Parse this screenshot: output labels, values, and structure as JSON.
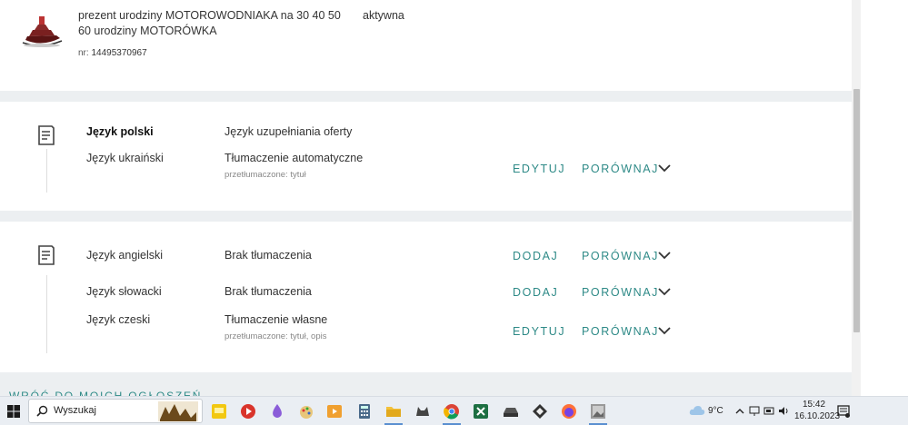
{
  "offer": {
    "title": "prezent urodziny MOTOROWODNIAKA na 30 40 50 60 urodziny MOTORÓWKA",
    "status": "aktywna",
    "nr_label": "nr:",
    "nr_value": "14495370967"
  },
  "section1": {
    "rows": [
      {
        "language": "Język polski",
        "status": "Język uzupełniania oferty",
        "sub": ""
      },
      {
        "language": "Język ukraiński",
        "status": "Tłumaczenie automatyczne",
        "sub": "przetłumaczone: tytuł"
      }
    ],
    "actions": {
      "edit": "EDYTUJ",
      "compare": "PORÓWNAJ"
    }
  },
  "section2": {
    "rows": [
      {
        "language": "Język angielski",
        "status": "Brak tłumaczenia",
        "sub": "",
        "action": "DODAJ",
        "compare": "PORÓWNAJ"
      },
      {
        "language": "Język słowacki",
        "status": "Brak tłumaczenia",
        "sub": "",
        "action": "DODAJ",
        "compare": "PORÓWNAJ"
      },
      {
        "language": "Język czeski",
        "status": "Tłumaczenie własne",
        "sub": "przetłumaczone: tytuł, opis",
        "action": "EDYTUJ",
        "compare": "PORÓWNAJ"
      }
    ]
  },
  "bottom_link": "WRÓĆ DO MOICH OGŁOSZEŃ",
  "taskbar": {
    "search_placeholder": "Wyszukaj",
    "weather": "9°C",
    "time": "15:42",
    "date": "16.10.2023"
  },
  "colors": {
    "accent": "#2e8a87",
    "separator": "#eceff1",
    "taskbar": "#eaeef3"
  }
}
